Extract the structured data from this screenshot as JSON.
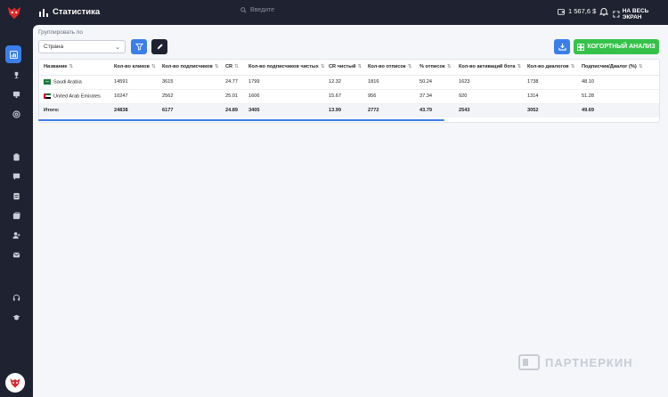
{
  "header": {
    "title": "Статистика",
    "search_placeholder": "Введите",
    "balance": "1 567,6 $",
    "fullscreen_label": "НА ВЕСЬ ЭКРАН"
  },
  "controls": {
    "group_label": "Группировать по",
    "group_value": "Страна",
    "cohort_label": "КОГОРТНЫЙ АНАЛИЗ"
  },
  "table": {
    "columns": [
      "Название",
      "Кол-во кликов",
      "Кол-во подписчиков",
      "CR",
      "Кол-во подписчиков чистых",
      "CR чистый",
      "Кол-во отписок",
      "% отписок",
      "Кол-во активаций бота",
      "Кол-во диалогов",
      "Подписчик/Диалог (%)"
    ],
    "rows": [
      {
        "name": "Saudi Arabia",
        "cells": [
          "14591",
          "3615",
          "24.77",
          "1799",
          "12.32",
          "1816",
          "50.24",
          "1623",
          "1738",
          "48.10"
        ]
      },
      {
        "name": "United Arab Emirates",
        "cells": [
          "10247",
          "2562",
          "25.01",
          "1606",
          "15.67",
          "956",
          "37.34",
          "920",
          "1314",
          "51.28"
        ]
      }
    ],
    "total": {
      "name": "Итого:",
      "cells": [
        "24838",
        "6177",
        "24.89",
        "3405",
        "13.99",
        "2772",
        "43.79",
        "2543",
        "3052",
        "49.69"
      ]
    }
  },
  "watermark": "ПАРТНЕРКИН",
  "colors": {
    "primary": "#3b7ee8",
    "success": "#36c24a",
    "sidebar": "#1f2230",
    "background": "#f4f6fa"
  },
  "icons": {
    "sidebar": [
      "chart-icon",
      "trophy-icon",
      "monitor-icon",
      "at-icon",
      "clipboard-icon",
      "chat-icon",
      "document-icon",
      "folder-icon",
      "user-plus-icon",
      "mail-icon",
      "headset-icon",
      "graduation-icon"
    ]
  }
}
